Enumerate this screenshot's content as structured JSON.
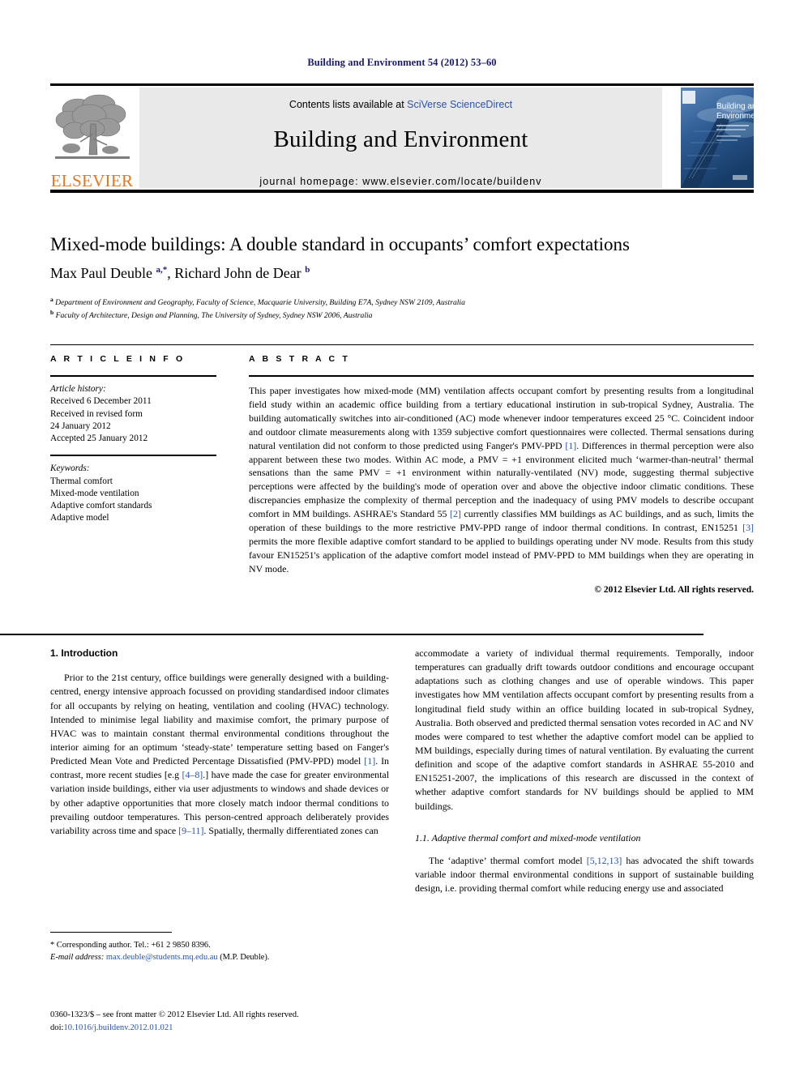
{
  "running_head": "Building and Environment 54 (2012) 53–60",
  "masthead": {
    "contents_prefix": "Contents lists available at ",
    "contents_link": "SciVerse ScienceDirect",
    "journal_title": "Building and Environment",
    "homepage": "journal homepage: www.elsevier.com/locate/buildenv",
    "publisher": "ELSEVIER",
    "cover_title_line1": "Building and",
    "cover_title_line2": "Environment"
  },
  "article": {
    "title": "Mixed-mode buildings: A double standard in occupants’ comfort expectations",
    "authors_html": "Max Paul Deuble <sup>a,*</sup>, Richard John de Dear <sup>b</sup>",
    "affiliation_a": "Department of Environment and Geography, Faculty of Science, Macquarie University, Building E7A, Sydney NSW 2109, Australia",
    "affiliation_b": "Faculty of Architecture, Design and Planning, The University of Sydney, Sydney NSW 2006, Australia"
  },
  "article_info": {
    "label": "A R T I C L E  I N F O",
    "history_label": "Article history:",
    "history": [
      "Received 6 December 2011",
      "Received in revised form",
      "24 January 2012",
      "Accepted 25 January 2012"
    ],
    "keywords_label": "Keywords:",
    "keywords": [
      "Thermal comfort",
      "Mixed-mode ventilation",
      "Adaptive comfort standards",
      "Adaptive model"
    ]
  },
  "abstract": {
    "label": "A B S T R A C T",
    "text_html": "This paper investigates how mixed-mode (MM) ventilation affects occupant comfort by presenting results from a longitudinal field study within an academic office building from a tertiary educational instirution in sub-tropical Sydney, Australia. The building automatically switches into air-conditioned (AC) mode whenever indoor temperatures exceed 25 °C. Coincident indoor and outdoor climate measurements along with 1359 subjective comfort questionnaires were collected. Thermal sensations during natural ventilation did not conform to those predicted using Fanger's PMV-PPD <span class=\"ref\">[1]</span>. Differences in thermal perception were also apparent between these two modes. Within AC mode, a PMV = +1 environment elicited much ‘warmer-than-neutral’ thermal sensations than the same PMV = +1 environment within naturally-ventilated (NV) mode, suggesting thermal subjective perceptions were affected by the building's mode of operation over and above the objective indoor climatic conditions. These discrepancies emphasize the complexity of thermal perception and the inadequacy of using PMV models to describe occupant comfort in MM buildings. ASHRAE's Standard 55 <span class=\"ref\">[2]</span> currently classifies MM buildings as AC buildings, and as such, limits the operation of these buildings to the more restrictive PMV-PPD range of indoor thermal conditions. In contrast, EN15251 <span class=\"ref\">[3]</span> permits the more flexible adaptive comfort standard to be applied to buildings operating under NV mode. Results from this study favour EN15251's application of the adaptive comfort model instead of PMV-PPD to MM buildings when they are operating in NV mode.",
    "copyright": "© 2012 Elsevier Ltd. All rights reserved."
  },
  "body": {
    "section1_title": "1.  Introduction",
    "section1_p1_html": "Prior to the 21st century, office buildings were generally designed with a building-centred, energy intensive approach focussed on providing standardised indoor climates for all occupants by relying on heating, ventilation and cooling (HVAC) technology. Intended to minimise legal liability and maximise comfort, the primary purpose of HVAC was to maintain constant thermal environmental conditions throughout the interior aiming for an optimum ‘steady-state’ temperature setting based on Fanger's Predicted Mean Vote and Predicted Percentage Dissatisfied (PMV-PPD) model <span class=\"ref\">[1]</span>. In contrast, more recent studies [e.g <span class=\"ref\">[4–8]</span>.] have made the case for greater environmental variation inside buildings, either via user adjustments to windows and shade devices or by other adaptive opportunities that more closely match indoor thermal conditions to prevailing outdoor temperatures. This person-centred approach deliberately provides variability across time and space <span class=\"ref\">[9–11]</span>. Spatially, thermally differentiated zones can accommodate a variety of individual thermal requirements. Temporally, indoor temperatures can gradually drift towards outdoor conditions and encourage occupant adaptations such as clothing changes and use of operable windows. This paper investigates how MM ventilation affects occupant comfort by presenting results from a longitudinal field study within an office building located in sub-tropical Sydney, Australia. Both observed and predicted thermal sensation votes recorded in AC and NV modes were compared to test whether the adaptive comfort model can be applied to MM buildings, especially during times of natural ventilation. By evaluating the current definition and scope of the adaptive comfort standards in ASHRAE 55-2010 and EN15251-2007, the implications of this research are discussed in the context of whether adaptive comfort standards for NV buildings should be applied to MM buildings.",
    "subsection11_title": "1.1.  Adaptive thermal comfort and mixed-mode ventilation",
    "subsection11_p1_html": "The ‘adaptive’ thermal comfort model <span class=\"ref\">[5,12,13]</span> has advocated the shift towards variable indoor thermal environmental conditions in support of sustainable building design, i.e. providing thermal comfort while reducing energy use and associated"
  },
  "footnote": {
    "corresponding_html": "* Corresponding author. Tel.: +61 2 9850 8396.",
    "email_label": "E-mail address:",
    "email": "max.deuble@students.mq.edu.au",
    "email_suffix": "(M.P. Deuble)."
  },
  "imprint": {
    "line1": "0360-1323/$ – see front matter © 2012 Elsevier Ltd. All rights reserved.",
    "doi_label": "doi:",
    "doi": "10.1016/j.buildenv.2012.01.021"
  },
  "colors": {
    "link": "#2b54a8",
    "running_head": "#1a1a6e",
    "elsevier_orange": "#e8761a",
    "panel_gray": "#e9e9e9"
  }
}
